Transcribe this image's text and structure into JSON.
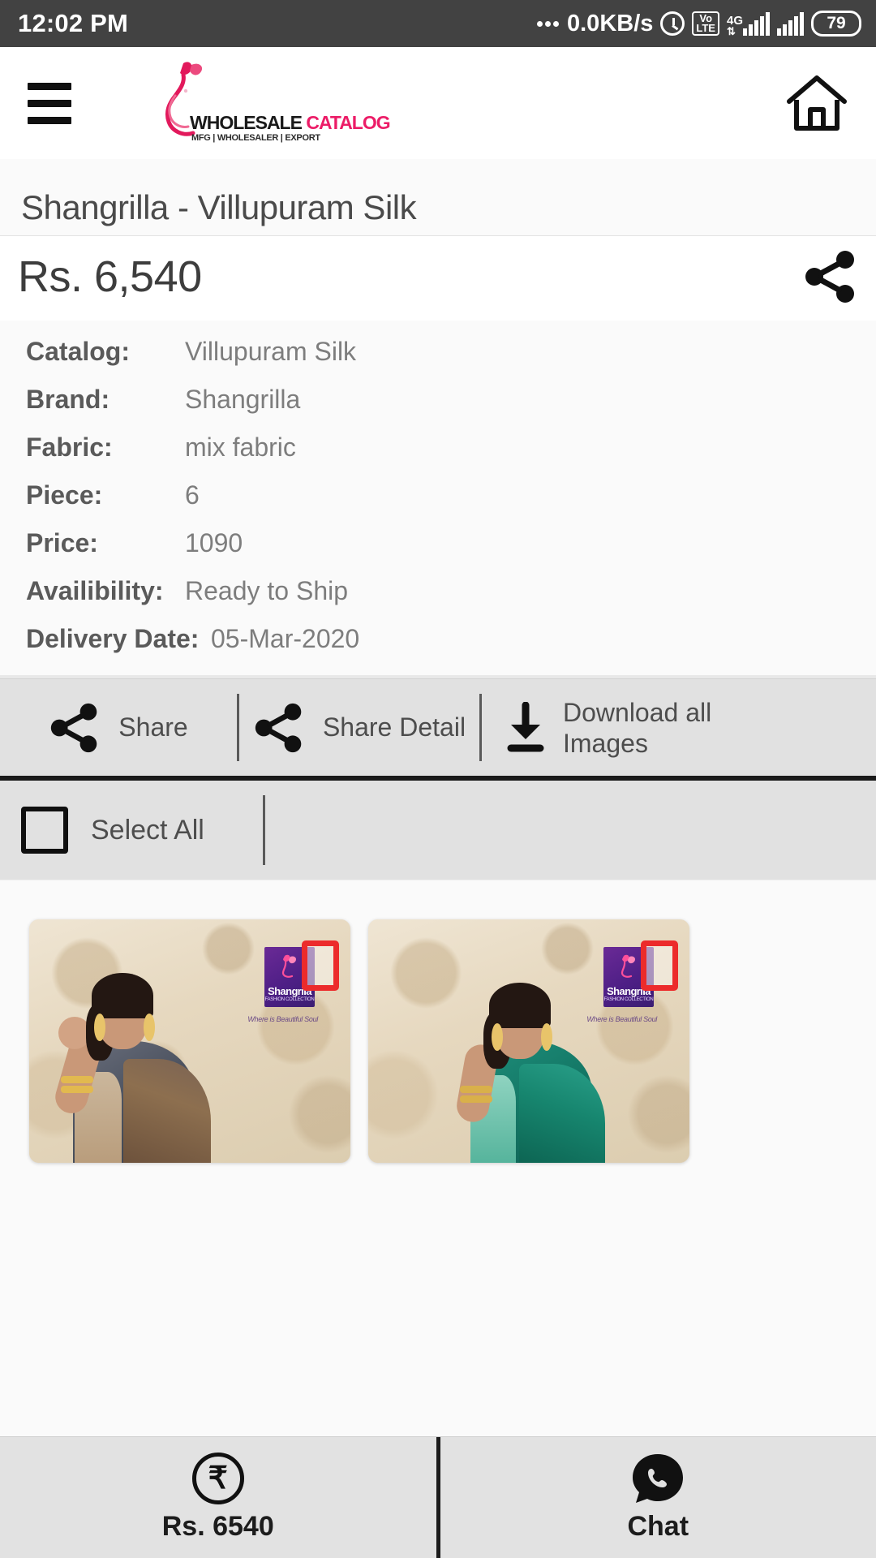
{
  "status_bar": {
    "time": "12:02 PM",
    "net_speed": "0.0KB/s",
    "volte_top": "Vo",
    "volte_bottom": "LTE",
    "network_type": "4G",
    "data_arrows": "⇅",
    "battery": "79"
  },
  "header": {
    "menu_icon": "hamburger-menu-icon",
    "logo_main_word1": "WHOLESALE",
    "logo_main_word2": "CATALOG",
    "logo_tagline": "MFG | WHOLESALER | EXPORT",
    "home_icon": "home-icon"
  },
  "product": {
    "title": "Shangrilla - Villupuram Silk",
    "price": "Rs. 6,540",
    "share_icon": "share-icon"
  },
  "details": {
    "rows": [
      {
        "label": "Catalog:",
        "value": "Villupuram Silk"
      },
      {
        "label": "Brand:",
        "value": "Shangrilla"
      },
      {
        "label": "Fabric:",
        "value": "mix fabric"
      },
      {
        "label": "Piece:",
        "value": "6"
      },
      {
        "label": "Price:",
        "value": "1090"
      },
      {
        "label": "Availibility:",
        "value": "Ready to Ship"
      },
      {
        "label": "Delivery Date:",
        "value": "05-Mar-2020"
      }
    ]
  },
  "actions": {
    "share_label": "Share",
    "share_icon": "share-icon",
    "share_detail_label": "Share Detail",
    "share_detail_icon": "share-icon",
    "download_label": "Download all Images",
    "download_icon": "download-icon"
  },
  "select": {
    "select_all_label": "Select All",
    "checkbox_icon": "checkbox-unchecked-icon",
    "checked": false
  },
  "gallery": {
    "items": [
      {
        "watermark_brand": "Shangrila",
        "watermark_sub": "FASHION COLLECTION",
        "watermark_caption": "Where is Beautiful Soul",
        "checkbox_icon": "checkbox-unchecked-icon",
        "selected": false
      },
      {
        "watermark_brand": "Shangrila",
        "watermark_sub": "FASHION COLLECTION",
        "watermark_caption": "Where is Beautiful Soul",
        "checkbox_icon": "checkbox-unchecked-icon",
        "selected": false
      }
    ]
  },
  "bottom_bar": {
    "price_label": "Rs. 6540",
    "price_icon": "rupee-circle-icon",
    "chat_label": "Chat",
    "chat_icon": "whatsapp-chat-icon"
  },
  "colors": {
    "status_bar_bg": "#424242",
    "brand_pink": "#ec1c67",
    "panel_bg": "#fafafa",
    "action_bg": "#e1e1e1",
    "checkbox_red": "#ec2b2b",
    "watermark_purple": "#4e1f86"
  }
}
